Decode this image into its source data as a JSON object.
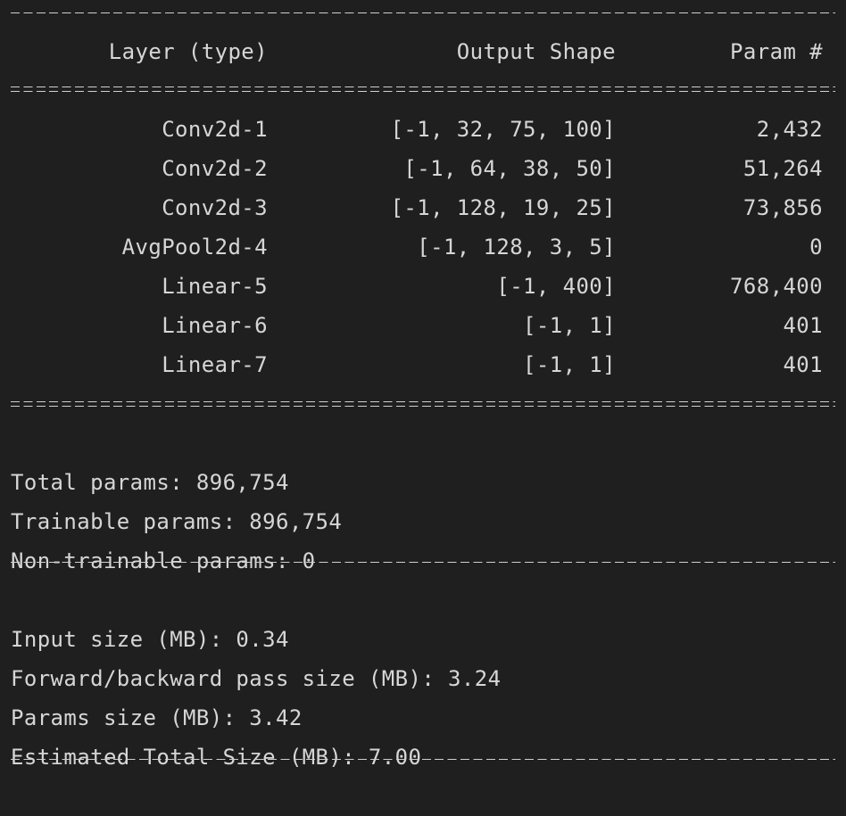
{
  "table": {
    "headers": {
      "layer": "Layer (type)",
      "output_shape": "Output Shape",
      "params": "Param #"
    },
    "rows": [
      {
        "layer": "Conv2d-1",
        "output_shape": "[-1, 32, 75, 100]",
        "params": "2,432"
      },
      {
        "layer": "Conv2d-2",
        "output_shape": "[-1, 64, 38, 50]",
        "params": "51,264"
      },
      {
        "layer": "Conv2d-3",
        "output_shape": "[-1, 128, 19, 25]",
        "params": "73,856"
      },
      {
        "layer": "AvgPool2d-4",
        "output_shape": "[-1, 128, 3, 5]",
        "params": "0"
      },
      {
        "layer": "Linear-5",
        "output_shape": "[-1, 400]",
        "params": "768,400"
      },
      {
        "layer": "Linear-6",
        "output_shape": "[-1, 1]",
        "params": "401"
      },
      {
        "layer": "Linear-7",
        "output_shape": "[-1, 1]",
        "params": "401"
      }
    ]
  },
  "params_summary": {
    "total": "Total params: 896,754",
    "trainable": "Trainable params: 896,754",
    "non_trainable": "Non-trainable params: 0"
  },
  "size_summary": {
    "input": "Input size (MB): 0.34",
    "forward_backward": "Forward/backward pass size (MB): 3.24",
    "params": "Params size (MB): 3.42",
    "total": "Estimated Total Size (MB): 7.00"
  },
  "colors": {
    "background": "#1f1f1f",
    "text": "#d6d6d6"
  }
}
